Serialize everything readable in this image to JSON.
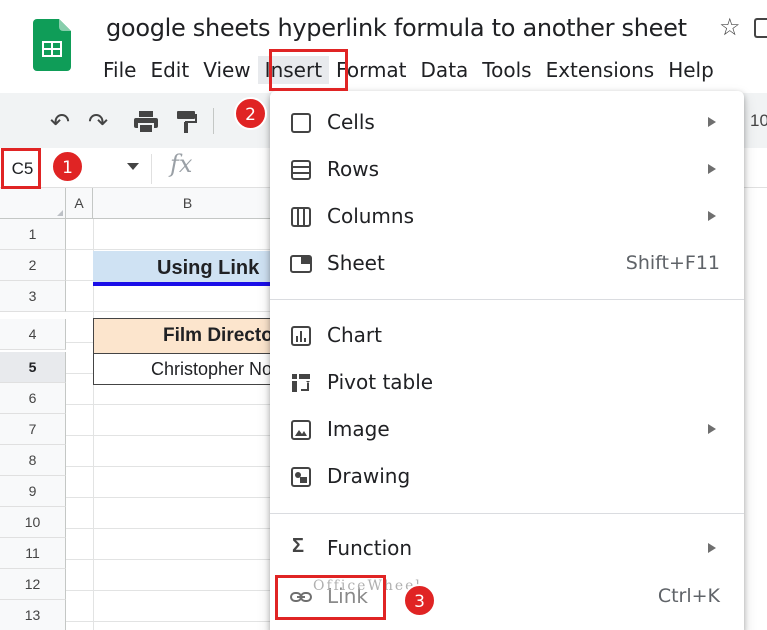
{
  "document": {
    "title": "google sheets hyperlink formula to another sheet"
  },
  "menubar": {
    "items": [
      "File",
      "Edit",
      "View",
      "Insert",
      "Format",
      "Data",
      "Tools",
      "Extensions",
      "Help"
    ]
  },
  "toolbar": {
    "zoom": "10"
  },
  "namebox": {
    "value": "C5"
  },
  "formula": {
    "fx": "fx",
    "value": ""
  },
  "columns": [
    "A",
    "B"
  ],
  "rows": [
    "1",
    "2",
    "3",
    "4",
    "5",
    "6",
    "7",
    "8",
    "9",
    "10",
    "11",
    "12",
    "13"
  ],
  "sheet": {
    "title_cell": "Using Link",
    "header_cell": "Film Director",
    "data_cell": "Christopher Nolan"
  },
  "insert_menu": {
    "items": [
      {
        "label": "Cells",
        "shortcut": "",
        "submenu": true,
        "icon": "cells-icon"
      },
      {
        "label": "Rows",
        "shortcut": "",
        "submenu": true,
        "icon": "rows-icon"
      },
      {
        "label": "Columns",
        "shortcut": "",
        "submenu": true,
        "icon": "columns-icon"
      },
      {
        "label": "Sheet",
        "shortcut": "Shift+F11",
        "submenu": false,
        "icon": "sheet-icon"
      },
      {
        "label": "Chart",
        "shortcut": "",
        "submenu": false,
        "icon": "chart-icon"
      },
      {
        "label": "Pivot table",
        "shortcut": "",
        "submenu": false,
        "icon": "pivot-table-icon"
      },
      {
        "label": "Image",
        "shortcut": "",
        "submenu": true,
        "icon": "image-icon"
      },
      {
        "label": "Drawing",
        "shortcut": "",
        "submenu": false,
        "icon": "drawing-icon"
      },
      {
        "label": "Function",
        "shortcut": "",
        "submenu": true,
        "icon": "function-icon"
      },
      {
        "label": "Link",
        "shortcut": "Ctrl+K",
        "submenu": false,
        "icon": "link-icon"
      }
    ]
  },
  "annotations": {
    "step1": "1",
    "step2": "2",
    "step3": "3"
  },
  "watermark": "OfficeWheel",
  "colors": {
    "accent_red": "#e02424",
    "title_fill": "#cfe2f3",
    "header_fill": "#fce5cd",
    "underline_blue": "#1a0ee8",
    "sheets_green": "#0f9d58"
  }
}
